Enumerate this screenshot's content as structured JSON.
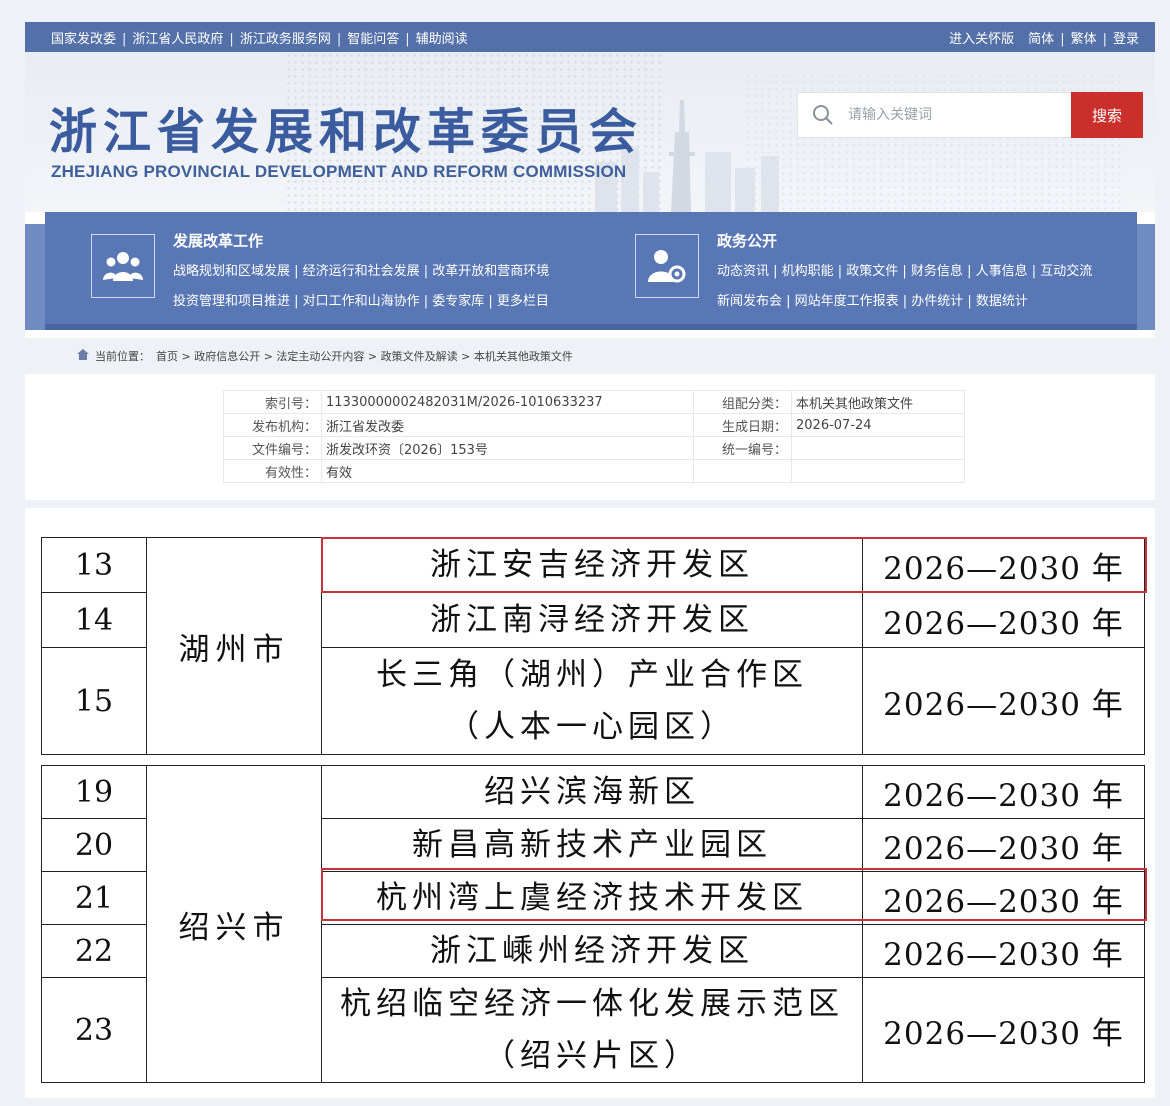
{
  "topbar": {
    "links": [
      "国家发改委",
      "浙江省人民政府",
      "浙江政务服务网",
      "智能问答",
      "辅助阅读"
    ],
    "care_mode": "进入关怀版",
    "simplified": "简体",
    "traditional": "繁体",
    "login": "登录"
  },
  "header": {
    "title_cn": "浙江省发展和改革委员会",
    "title_en": "ZHEJIANG PROVINCIAL DEVELOPMENT AND REFORM COMMISSION",
    "search_placeholder": "请输入关键词",
    "search_button": "搜索"
  },
  "nav": {
    "block1": {
      "title": "发展改革工作",
      "line1": "战略规划和区域发展 | 经济运行和社会发展 | 改革开放和营商环境",
      "line2": "投资管理和项目推进 | 对口工作和山海协作 | 委专家库 | 更多栏目",
      "icon": "people-group-icon"
    },
    "block2": {
      "title": "政务公开",
      "line1": "动态资讯 | 机构职能 | 政策文件 | 财务信息 | 人事信息 | 互动交流",
      "line2": "新闻发布会 | 网站年度工作报表 | 办件统计 | 数据统计",
      "icon": "user-gear-icon"
    }
  },
  "breadcrumb": {
    "label": "当前位置：",
    "path": "首页 > 政府信息公开 > 法定主动公开内容 > 政策文件及解读 > 本机关其他政策文件"
  },
  "meta": {
    "index_label": "索引号：",
    "index_value": "11330000002482031M/2026-1010633237",
    "category_label": "组配分类：",
    "category_value": "本机关其他政策文件",
    "publisher_label": "发布机构：",
    "publisher_value": "浙江省发改委",
    "date_label": "生成日期：",
    "date_value": "2026-07-24",
    "docno_label": "文件编号：",
    "docno_value": "浙发改环资〔2026〕153号",
    "unified_label": "统一编号：",
    "unified_value": "",
    "validity_label": "有效性：",
    "validity_value": "有效"
  },
  "table_huzhou": {
    "city": "湖州市",
    "rows": [
      {
        "no": "13",
        "zone": "浙江安吉经济开发区",
        "zone2": "",
        "years": "2026—2030 年"
      },
      {
        "no": "14",
        "zone": "浙江南浔经济开发区",
        "zone2": "",
        "years": "2026—2030 年"
      },
      {
        "no": "15",
        "zone": "长三角（湖州）产业合作区",
        "zone2": "（人本一心园区）",
        "years": "2026—2030 年"
      }
    ]
  },
  "table_shaoxing": {
    "city": "绍兴市",
    "rows": [
      {
        "no": "19",
        "zone": "绍兴滨海新区",
        "zone2": "",
        "years": "2026—2030 年"
      },
      {
        "no": "20",
        "zone": "新昌高新技术产业园区",
        "zone2": "",
        "years": "2026—2030 年"
      },
      {
        "no": "21",
        "zone": "杭州湾上虞经济技术开发区",
        "zone2": "",
        "years": "2026—2030 年"
      },
      {
        "no": "22",
        "zone": "浙江嵊州经济开发区",
        "zone2": "",
        "years": "2026—2030 年"
      },
      {
        "no": "23",
        "zone": "杭绍临空经济一体化发展示范区",
        "zone2": "（绍兴片区）",
        "years": "2026—2030 年"
      }
    ]
  },
  "colors": {
    "topbar": "#5470a8",
    "nav_panel": "#5877b4",
    "title": "#3a5c9f",
    "search_button": "#c9302c",
    "highlight": "#c4343a"
  }
}
